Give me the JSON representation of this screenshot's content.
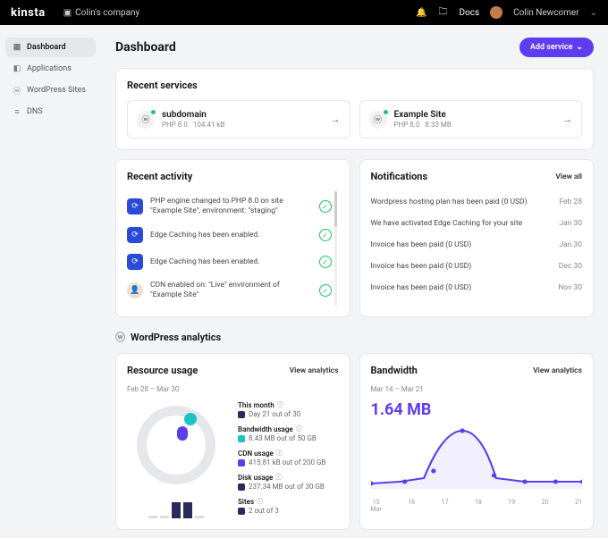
{
  "topbar": {
    "logo": "kinsta",
    "company": "Colin's company",
    "docs": "Docs",
    "username": "Colin Newcomer"
  },
  "sidebar": {
    "items": [
      {
        "icon": "dashboard",
        "label": "Dashboard"
      },
      {
        "icon": "apps",
        "label": "Applications"
      },
      {
        "icon": "wp",
        "label": "WordPress Sites"
      },
      {
        "icon": "dns",
        "label": "DNS"
      }
    ]
  },
  "page": {
    "title": "Dashboard",
    "add_service": "Add service"
  },
  "recent_services": {
    "title": "Recent services",
    "items": [
      {
        "name": "subdomain",
        "php": "PHP 8.0",
        "size": "104.41 kB"
      },
      {
        "name": "Example Site",
        "php": "PHP 8.0",
        "size": "8.33 MB"
      }
    ]
  },
  "activity": {
    "title": "Recent activity",
    "items": [
      {
        "icon": "engine",
        "text": "PHP engine changed to PHP 8.0 on site \"Example Site\", environment: \"staging\""
      },
      {
        "icon": "engine",
        "text": "Edge Caching has been enabled."
      },
      {
        "icon": "engine",
        "text": "Edge Caching has been enabled."
      },
      {
        "icon": "person",
        "text": "CDN enabled on: \"Live\" environment of \"Example Site\""
      }
    ]
  },
  "notifications": {
    "title": "Notifications",
    "view_all": "View all",
    "items": [
      {
        "text": "Wordpress hosting plan has been paid (0 USD)",
        "date": "Feb 28"
      },
      {
        "text": "We have activated Edge Caching for your site",
        "date": "Jan 30"
      },
      {
        "text": "Invoice has been paid (0 USD)",
        "date": "Jan 30"
      },
      {
        "text": "Invoice has been paid (0 USD)",
        "date": "Dec 30"
      },
      {
        "text": "Invoice has been paid (0 USD)",
        "date": "Nov 30"
      }
    ]
  },
  "analytics": {
    "title": "WordPress analytics"
  },
  "resource": {
    "title": "Resource usage",
    "view": "View analytics",
    "range": "Feb 28 – Mar 30",
    "rows": [
      {
        "label": "This month",
        "val": "Day 21 out of 30",
        "color": "#2a2a5e"
      },
      {
        "label": "Bandwidth usage",
        "val": "8.43 MB out of 50 GB",
        "color": "#1ac4c4"
      },
      {
        "label": "CDN usage",
        "val": "415.81 kB out of 200 GB",
        "color": "#5e3cf0"
      },
      {
        "label": "Disk usage",
        "val": "237.34 MB out of 30 GB",
        "color": "#2a2a5e"
      },
      {
        "label": "Sites",
        "val": "2 out of 3",
        "color": "#2a2a5e"
      }
    ]
  },
  "bandwidth": {
    "title": "Bandwidth",
    "view": "View analytics",
    "range": "Mar 14 – Mar 21",
    "total": "1.64 MB",
    "xaxis": [
      "15",
      "16",
      "17",
      "18",
      "19",
      "20",
      "21"
    ],
    "xmonth": "Mar"
  },
  "chart_data": {
    "type": "area",
    "title": "Bandwidth",
    "x": [
      "Mar 15",
      "Mar 16",
      "Mar 17",
      "Mar 18",
      "Mar 19",
      "Mar 20",
      "Mar 21"
    ],
    "values": [
      0.05,
      0.1,
      0.9,
      0.25,
      0.05,
      0.05,
      0.05
    ],
    "ylabel": "MB",
    "ylim": [
      0,
      1.0
    ]
  }
}
